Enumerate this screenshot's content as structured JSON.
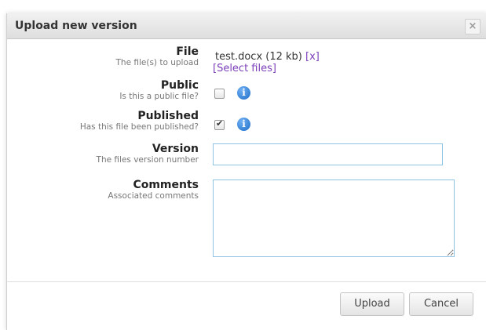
{
  "dialog": {
    "title": "Upload new version",
    "close_label": "×"
  },
  "form": {
    "file": {
      "label": "File",
      "hint": "The file(s) to upload",
      "file_name": "test.docx (12 kb)",
      "remove_label": "[x]",
      "select_label": "[Select files]"
    },
    "public": {
      "label": "Public",
      "hint": "Is this a public file?",
      "checked": false,
      "info_icon": "info-icon",
      "info_glyph": "i"
    },
    "published": {
      "label": "Published",
      "hint": "Has this file been published?",
      "checked": true,
      "check_glyph": "✔",
      "info_icon": "info-icon",
      "info_glyph": "i"
    },
    "version": {
      "label": "Version",
      "hint": "The files version number",
      "value": "",
      "placeholder": ""
    },
    "comments": {
      "label": "Comments",
      "hint": "Associated comments",
      "value": "",
      "placeholder": ""
    }
  },
  "footer": {
    "upload_label": "Upload",
    "cancel_label": "Cancel"
  },
  "colors": {
    "link": "#7b3fb8",
    "info_icon": "#1f6ec9",
    "input_border": "#8fc3e3"
  }
}
